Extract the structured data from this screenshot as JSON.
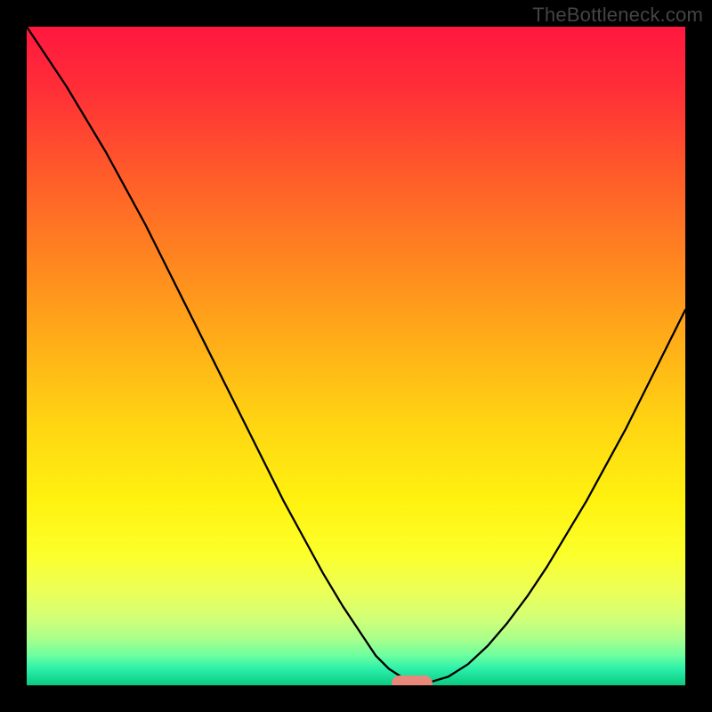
{
  "watermark": "TheBottleneck.com",
  "chart_data": {
    "type": "line",
    "title": "",
    "xlabel": "",
    "ylabel": "",
    "ylim": [
      0,
      100
    ],
    "xlim": [
      0,
      100
    ],
    "curve": {
      "comment": "V-shaped bottleneck curve; values are percentage-of-height from bottom (0=bottom,100=top). x is percentage across width.",
      "x": [
        0,
        3,
        6,
        9,
        12,
        15,
        18,
        21,
        24,
        27,
        30,
        33,
        36,
        39,
        42,
        45,
        48,
        51,
        53,
        55,
        57,
        59,
        61,
        64,
        67,
        70,
        73,
        76,
        79,
        82,
        85,
        88,
        91,
        94,
        97,
        100
      ],
      "y": [
        100,
        95.5,
        91,
        86,
        81,
        75.5,
        70,
        64,
        58,
        52,
        46,
        40,
        34,
        28,
        22.5,
        17,
        12,
        7.5,
        4.5,
        2.5,
        1.2,
        0.4,
        0.4,
        1.3,
        3.2,
        6.0,
        9.5,
        13.5,
        18.0,
        23.0,
        28.0,
        33.5,
        39.0,
        45.0,
        51.0,
        57.0
      ]
    },
    "minimum_marker": {
      "x": 58.5,
      "y": 0
    },
    "gradient_stops": [
      {
        "offset": 0.0,
        "color": "#ff173f"
      },
      {
        "offset": 0.1,
        "color": "#ff3037"
      },
      {
        "offset": 0.22,
        "color": "#ff5a2a"
      },
      {
        "offset": 0.35,
        "color": "#ff8420"
      },
      {
        "offset": 0.48,
        "color": "#ffae18"
      },
      {
        "offset": 0.6,
        "color": "#ffd412"
      },
      {
        "offset": 0.72,
        "color": "#fff210"
      },
      {
        "offset": 0.8,
        "color": "#fcff2a"
      },
      {
        "offset": 0.86,
        "color": "#eaff5a"
      },
      {
        "offset": 0.9,
        "color": "#d0ff78"
      },
      {
        "offset": 0.93,
        "color": "#a8ff8c"
      },
      {
        "offset": 0.955,
        "color": "#6cffa0"
      },
      {
        "offset": 0.975,
        "color": "#2cf0a9"
      },
      {
        "offset": 1.0,
        "color": "#09c983"
      }
    ]
  }
}
